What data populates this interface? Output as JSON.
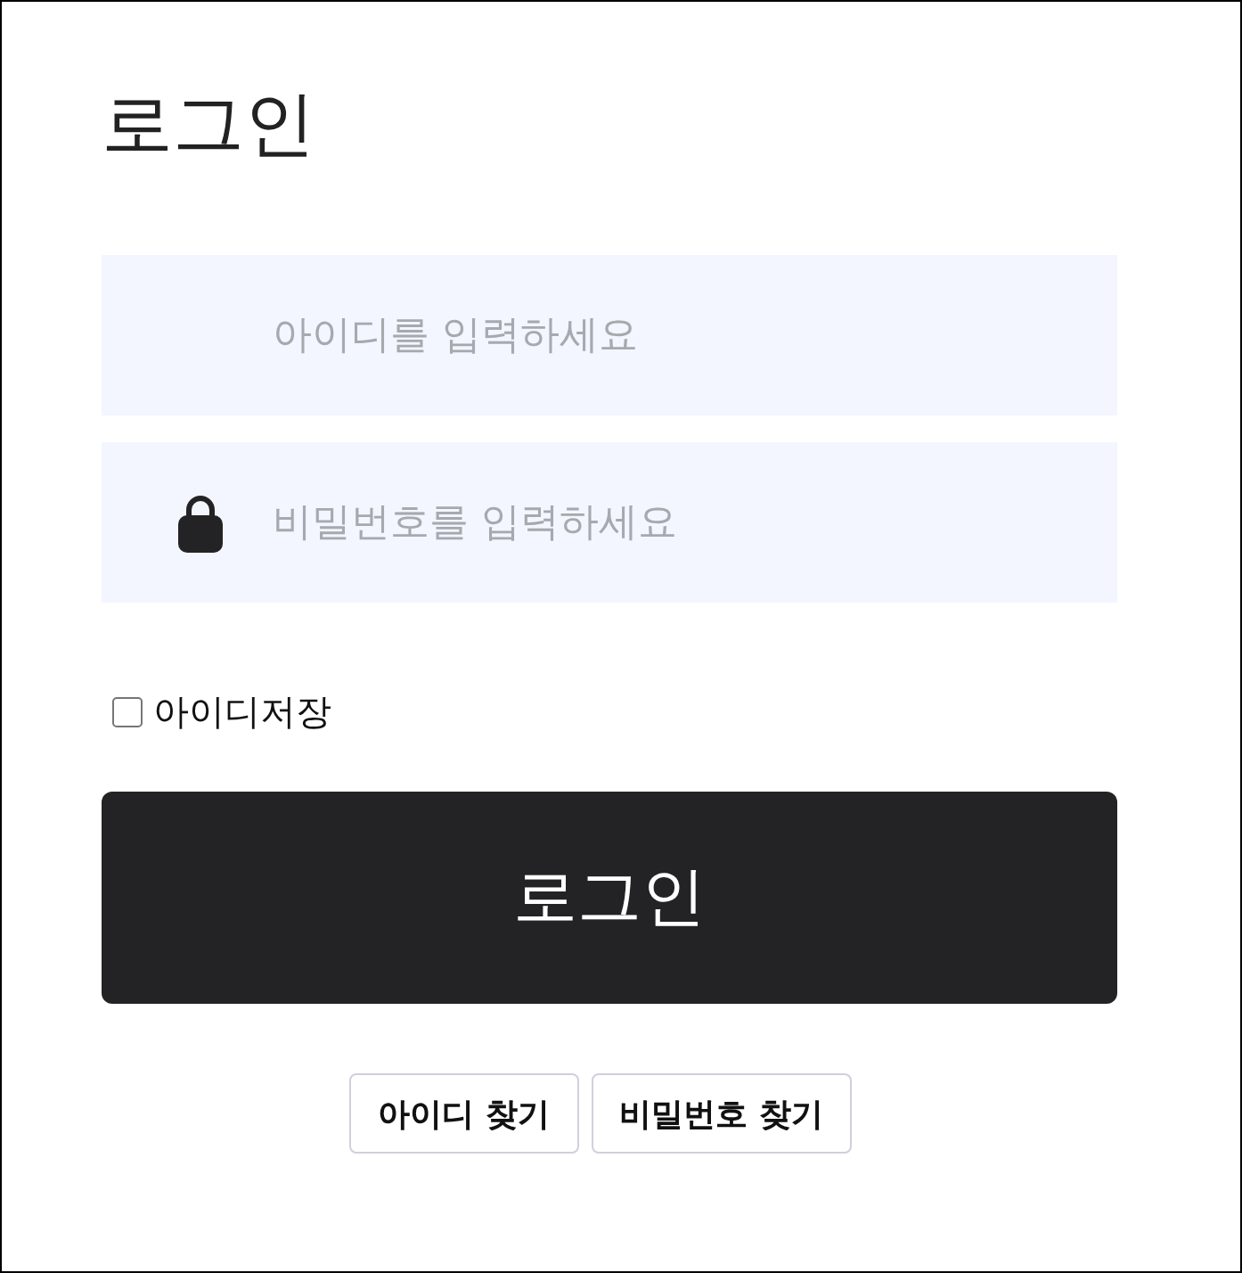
{
  "title": "로그인",
  "fields": [
    {
      "kind": "text",
      "placeholder": "아이디를 입력하세요"
    },
    {
      "kind": "password",
      "placeholder": "비밀번호를 입력하세요"
    }
  ],
  "remember": {
    "label": "아이디저장",
    "checked": false
  },
  "login_button": {
    "label": "로그인"
  },
  "links": [
    {
      "label": "아이디 찾기"
    },
    {
      "label": "비밀번호 찾기"
    }
  ]
}
